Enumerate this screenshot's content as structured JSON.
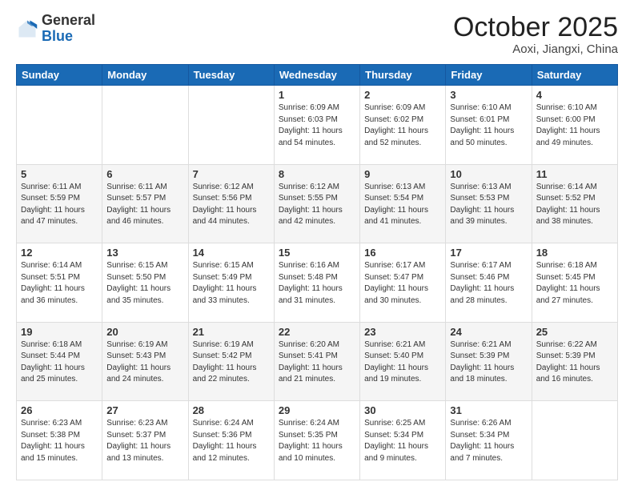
{
  "header": {
    "logo_general": "General",
    "logo_blue": "Blue",
    "month_title": "October 2025",
    "location": "Aoxi, Jiangxi, China"
  },
  "weekdays": [
    "Sunday",
    "Monday",
    "Tuesday",
    "Wednesday",
    "Thursday",
    "Friday",
    "Saturday"
  ],
  "weeks": [
    [
      {
        "day": "",
        "info": ""
      },
      {
        "day": "",
        "info": ""
      },
      {
        "day": "",
        "info": ""
      },
      {
        "day": "1",
        "info": "Sunrise: 6:09 AM\nSunset: 6:03 PM\nDaylight: 11 hours\nand 54 minutes."
      },
      {
        "day": "2",
        "info": "Sunrise: 6:09 AM\nSunset: 6:02 PM\nDaylight: 11 hours\nand 52 minutes."
      },
      {
        "day": "3",
        "info": "Sunrise: 6:10 AM\nSunset: 6:01 PM\nDaylight: 11 hours\nand 50 minutes."
      },
      {
        "day": "4",
        "info": "Sunrise: 6:10 AM\nSunset: 6:00 PM\nDaylight: 11 hours\nand 49 minutes."
      }
    ],
    [
      {
        "day": "5",
        "info": "Sunrise: 6:11 AM\nSunset: 5:59 PM\nDaylight: 11 hours\nand 47 minutes."
      },
      {
        "day": "6",
        "info": "Sunrise: 6:11 AM\nSunset: 5:57 PM\nDaylight: 11 hours\nand 46 minutes."
      },
      {
        "day": "7",
        "info": "Sunrise: 6:12 AM\nSunset: 5:56 PM\nDaylight: 11 hours\nand 44 minutes."
      },
      {
        "day": "8",
        "info": "Sunrise: 6:12 AM\nSunset: 5:55 PM\nDaylight: 11 hours\nand 42 minutes."
      },
      {
        "day": "9",
        "info": "Sunrise: 6:13 AM\nSunset: 5:54 PM\nDaylight: 11 hours\nand 41 minutes."
      },
      {
        "day": "10",
        "info": "Sunrise: 6:13 AM\nSunset: 5:53 PM\nDaylight: 11 hours\nand 39 minutes."
      },
      {
        "day": "11",
        "info": "Sunrise: 6:14 AM\nSunset: 5:52 PM\nDaylight: 11 hours\nand 38 minutes."
      }
    ],
    [
      {
        "day": "12",
        "info": "Sunrise: 6:14 AM\nSunset: 5:51 PM\nDaylight: 11 hours\nand 36 minutes."
      },
      {
        "day": "13",
        "info": "Sunrise: 6:15 AM\nSunset: 5:50 PM\nDaylight: 11 hours\nand 35 minutes."
      },
      {
        "day": "14",
        "info": "Sunrise: 6:15 AM\nSunset: 5:49 PM\nDaylight: 11 hours\nand 33 minutes."
      },
      {
        "day": "15",
        "info": "Sunrise: 6:16 AM\nSunset: 5:48 PM\nDaylight: 11 hours\nand 31 minutes."
      },
      {
        "day": "16",
        "info": "Sunrise: 6:17 AM\nSunset: 5:47 PM\nDaylight: 11 hours\nand 30 minutes."
      },
      {
        "day": "17",
        "info": "Sunrise: 6:17 AM\nSunset: 5:46 PM\nDaylight: 11 hours\nand 28 minutes."
      },
      {
        "day": "18",
        "info": "Sunrise: 6:18 AM\nSunset: 5:45 PM\nDaylight: 11 hours\nand 27 minutes."
      }
    ],
    [
      {
        "day": "19",
        "info": "Sunrise: 6:18 AM\nSunset: 5:44 PM\nDaylight: 11 hours\nand 25 minutes."
      },
      {
        "day": "20",
        "info": "Sunrise: 6:19 AM\nSunset: 5:43 PM\nDaylight: 11 hours\nand 24 minutes."
      },
      {
        "day": "21",
        "info": "Sunrise: 6:19 AM\nSunset: 5:42 PM\nDaylight: 11 hours\nand 22 minutes."
      },
      {
        "day": "22",
        "info": "Sunrise: 6:20 AM\nSunset: 5:41 PM\nDaylight: 11 hours\nand 21 minutes."
      },
      {
        "day": "23",
        "info": "Sunrise: 6:21 AM\nSunset: 5:40 PM\nDaylight: 11 hours\nand 19 minutes."
      },
      {
        "day": "24",
        "info": "Sunrise: 6:21 AM\nSunset: 5:39 PM\nDaylight: 11 hours\nand 18 minutes."
      },
      {
        "day": "25",
        "info": "Sunrise: 6:22 AM\nSunset: 5:39 PM\nDaylight: 11 hours\nand 16 minutes."
      }
    ],
    [
      {
        "day": "26",
        "info": "Sunrise: 6:23 AM\nSunset: 5:38 PM\nDaylight: 11 hours\nand 15 minutes."
      },
      {
        "day": "27",
        "info": "Sunrise: 6:23 AM\nSunset: 5:37 PM\nDaylight: 11 hours\nand 13 minutes."
      },
      {
        "day": "28",
        "info": "Sunrise: 6:24 AM\nSunset: 5:36 PM\nDaylight: 11 hours\nand 12 minutes."
      },
      {
        "day": "29",
        "info": "Sunrise: 6:24 AM\nSunset: 5:35 PM\nDaylight: 11 hours\nand 10 minutes."
      },
      {
        "day": "30",
        "info": "Sunrise: 6:25 AM\nSunset: 5:34 PM\nDaylight: 11 hours\nand 9 minutes."
      },
      {
        "day": "31",
        "info": "Sunrise: 6:26 AM\nSunset: 5:34 PM\nDaylight: 11 hours\nand 7 minutes."
      },
      {
        "day": "",
        "info": ""
      }
    ]
  ]
}
